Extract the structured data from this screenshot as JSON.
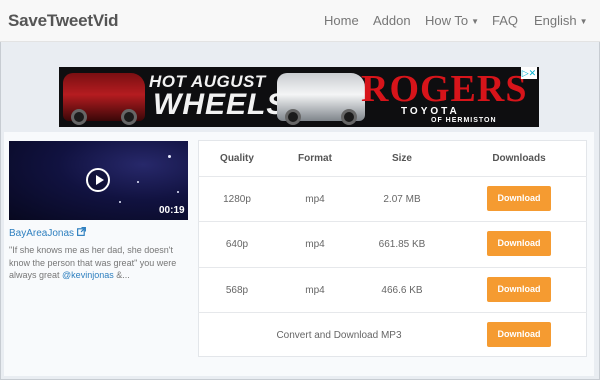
{
  "navbar": {
    "brand": "SaveTweetVid",
    "items": [
      {
        "label": "Home"
      },
      {
        "label": "Addon"
      },
      {
        "label": "How To"
      },
      {
        "label": "FAQ"
      },
      {
        "label": "English"
      }
    ]
  },
  "ad": {
    "line1": "HOT AUGUST",
    "line2": "WHEELS",
    "brand": "ROGERS",
    "sub1": "TOYOTA",
    "sub2": "OF HERMISTON",
    "choices_icon": "ad-choices-icon"
  },
  "video": {
    "duration": "00:19",
    "author": "BayAreaJonas",
    "tweet_text": "\"If she knows me as her dad, she doesn't know the person that was great\" you were always great",
    "tweet_mention": "@kevinjonas",
    "tweet_tail": " &...",
    "icons": {
      "play": "play-icon",
      "external": "external-link-icon"
    }
  },
  "table": {
    "headers": {
      "quality": "Quality",
      "format": "Format",
      "size": "Size",
      "downloads": "Downloads"
    },
    "rows": [
      {
        "quality": "1280p",
        "format": "mp4",
        "size": "2.07 MB",
        "button": "Download"
      },
      {
        "quality": "640p",
        "format": "mp4",
        "size": "661.85 KB",
        "button": "Download"
      },
      {
        "quality": "568p",
        "format": "mp4",
        "size": "466.6 KB",
        "button": "Download"
      }
    ],
    "mp3": {
      "label": "Convert and Download MP3",
      "button": "Download"
    }
  },
  "colors": {
    "accent": "#f59b31",
    "link": "#2d7fbf",
    "navbar_bg": "#f8f8f8"
  }
}
